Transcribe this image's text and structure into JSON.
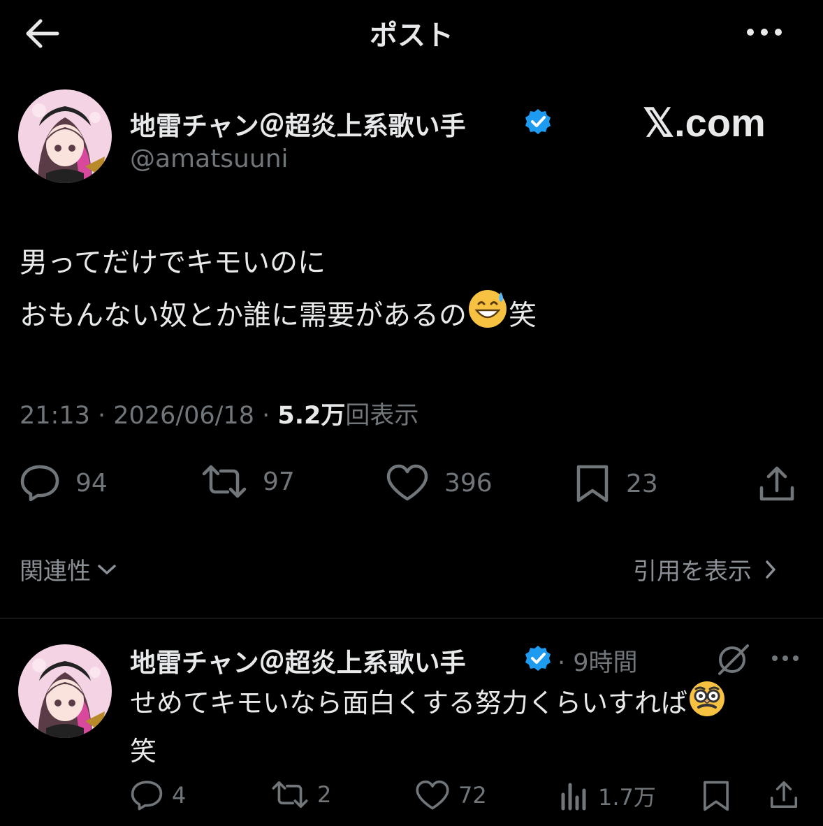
{
  "header": {
    "title": "ポスト",
    "back_icon": "arrow-left-icon",
    "more_icon": "more-dots-icon"
  },
  "watermark": "𝕏.com",
  "post": {
    "author_name": "地雷チャン＠超炎上系歌い手",
    "handle": "@amatsuuni",
    "text_lines": [
      "男ってだけでキモいのに",
      "おもんない奴とか誰に需要があるの",
      "笑"
    ],
    "time": "21:13 · 2026/06/18 · ",
    "views_number": "5.2万",
    "views_label": "回表示",
    "counts": {
      "replies": "94",
      "reposts": "97",
      "likes": "396",
      "bookmarks": "23"
    },
    "related_label": "関連性",
    "quotes_label": "引用を表示"
  },
  "reply": {
    "author_name": "地雷チャン＠超炎上系歌い手",
    "time": "· 9時間",
    "text_line1": "せめてキモいなら面白くする努力くらいすれば",
    "text_line2": "笑",
    "counts": {
      "replies": "4",
      "reposts": "2",
      "likes": "72",
      "views": "1.7万"
    }
  },
  "colors": {
    "background": "#000000",
    "text": "#e7e9ea",
    "muted": "#71767b",
    "verified": "#1d9bf0"
  }
}
